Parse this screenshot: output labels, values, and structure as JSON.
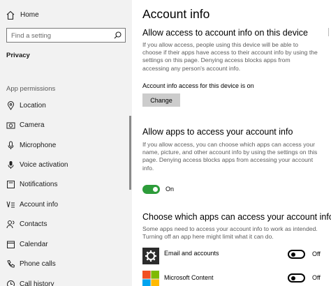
{
  "sidebar": {
    "home_label": "Home",
    "search_placeholder": "Find a setting",
    "category": "Privacy",
    "section_label": "App permissions",
    "items": [
      {
        "label": "Location",
        "icon": "location-icon"
      },
      {
        "label": "Camera",
        "icon": "camera-icon"
      },
      {
        "label": "Microphone",
        "icon": "microphone-icon"
      },
      {
        "label": "Voice activation",
        "icon": "voice-activation-icon"
      },
      {
        "label": "Notifications",
        "icon": "notifications-icon"
      },
      {
        "label": "Account info",
        "icon": "account-info-icon"
      },
      {
        "label": "Contacts",
        "icon": "contacts-icon"
      },
      {
        "label": "Calendar",
        "icon": "calendar-icon"
      },
      {
        "label": "Phone calls",
        "icon": "phone-icon"
      },
      {
        "label": "Call history",
        "icon": "call-history-icon"
      }
    ]
  },
  "main": {
    "title": "Account info",
    "device_section": {
      "heading": "Allow access to account info on this device",
      "description": "If you allow access, people using this device will be able to choose if their apps have access to their account info by using the settings on this page. Denying access blocks apps from accessing any person's account info.",
      "status": "Account info access for this device is on",
      "button_label": "Change"
    },
    "apps_section": {
      "heading": "Allow apps to access your account info",
      "description": "If you allow access, you can choose which apps can access your name, picture, and other account info by using the settings on this page. Denying access blocks apps from accessing your account info.",
      "toggle_state": "On"
    },
    "choose_section": {
      "heading": "Choose which apps can access your account info",
      "description": "Some apps need to access your account info to work as intended. Turning off an app here might limit what it can do.",
      "apps": [
        {
          "name": "Email and accounts",
          "state": "Off",
          "icon": "gear-icon"
        },
        {
          "name": "Microsoft Content",
          "state": "Off",
          "icon": "microsoft-logo-icon"
        }
      ]
    }
  },
  "colors": {
    "sidebar_bg": "#f2f2f2",
    "toggle_on": "#2d9c3a",
    "button_bg": "#cccccc"
  }
}
